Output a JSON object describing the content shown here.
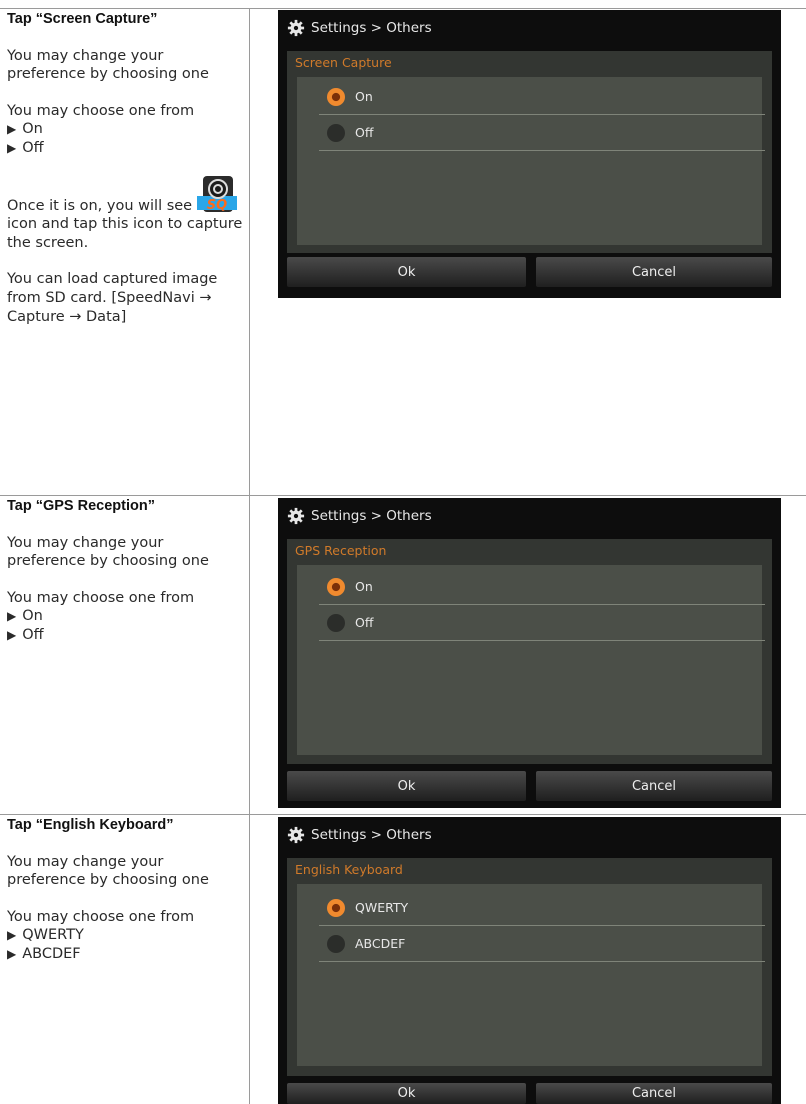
{
  "sections": [
    {
      "title": "Tap “Screen Capture”",
      "desc": "You may change your preference by choosing one",
      "choose": "You may choose one from",
      "options": [
        "On",
        "Off"
      ],
      "extra1_pre": "Once it is on, you will see",
      "extra1_post": "icon and tap this icon to capture the screen.",
      "extra2": "You can load captured image from SD card. [SpeedNavi → Capture → Data]",
      "icon_text": "SQ",
      "device": {
        "header": "Settings > Others",
        "panel_label": "Screen Capture",
        "radio_options": [
          "On",
          "Off"
        ],
        "selected_index": 0,
        "ok": "Ok",
        "cancel": "Cancel"
      }
    },
    {
      "title": "Tap “GPS Reception”",
      "desc": "You may change your preference by choosing one",
      "choose": "You may choose one from",
      "options": [
        "On",
        "Off"
      ],
      "device": {
        "header": "Settings > Others",
        "panel_label": "GPS Reception",
        "radio_options": [
          "On",
          "Off"
        ],
        "selected_index": 0,
        "ok": "Ok",
        "cancel": "Cancel"
      }
    },
    {
      "title": "Tap “English Keyboard”",
      "desc": "You may change your preference by choosing one",
      "choose": "You may choose one from",
      "options": [
        "QWERTY",
        "ABCDEF"
      ],
      "device": {
        "header": "Settings > Others",
        "panel_label": "English Keyboard",
        "radio_options": [
          "QWERTY",
          "ABCDEF"
        ],
        "selected_index": 0,
        "ok": "Ok",
        "cancel": "Cancel"
      }
    }
  ],
  "colors": {
    "accent_orange": "#f08a2e",
    "label_orange": "#d07a2a",
    "device_bg": "#0d0d0d",
    "panel_bg": "#4b4f48"
  },
  "icons": {
    "header_icon": "gear-icon",
    "capture_icon": "screen-capture-camera-icon",
    "bullet": "triangle-bullet-icon"
  }
}
